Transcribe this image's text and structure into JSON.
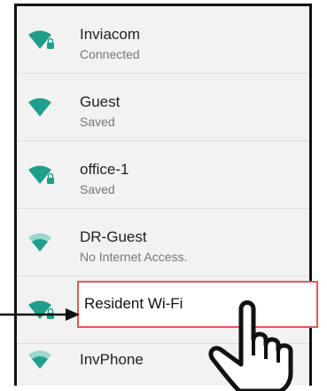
{
  "networks": [
    {
      "name": "Inviacom",
      "status": "Connected",
      "signal": 1.0,
      "locked": true,
      "color": "#1f9f8b"
    },
    {
      "name": "Guest",
      "status": "Saved",
      "signal": 1.0,
      "locked": false,
      "color": "#1f9f8b"
    },
    {
      "name": "office-1",
      "status": "Saved",
      "signal": 1.0,
      "locked": true,
      "color": "#1f9f8b"
    },
    {
      "name": "DR-Guest",
      "status": "No Internet Access.",
      "signal": 0.66,
      "locked": false,
      "color": "#1f9f8b"
    },
    {
      "name": "Resident Wi-Fi",
      "status": "",
      "signal": 1.0,
      "locked": true,
      "color": "#1f9f8b"
    },
    {
      "name": "InvPhone",
      "status": "",
      "signal": 0.66,
      "locked": false,
      "color": "#1f9f8b"
    }
  ],
  "highlight_label": "Resident Wi-Fi"
}
